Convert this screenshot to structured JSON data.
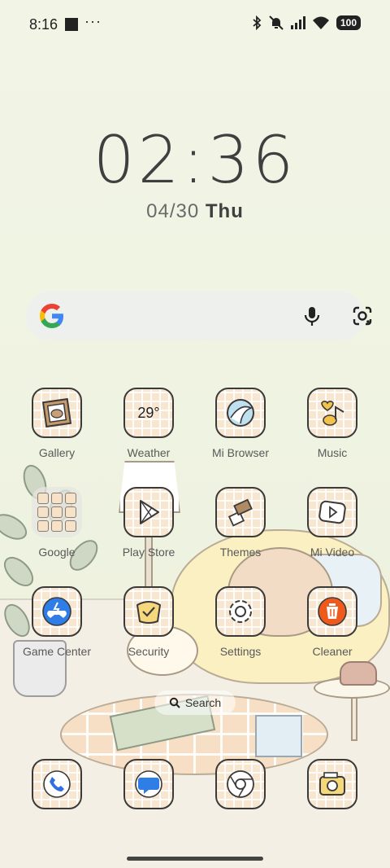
{
  "status_bar": {
    "time": "8:16",
    "more": "···",
    "battery": "100",
    "icons": [
      "square-notification-icon",
      "bluetooth-icon",
      "mute-icon",
      "signal-icon",
      "wifi-icon",
      "battery-icon"
    ]
  },
  "clock_widget": {
    "time": "02:36",
    "date": "04/30",
    "weekday": "Thu"
  },
  "search_widget": {
    "icons": [
      "google-g-icon",
      "mic-icon",
      "google-lens-icon"
    ]
  },
  "apps": [
    {
      "label": "Gallery",
      "icon": "gallery-icon"
    },
    {
      "label": "Weather",
      "icon": "weather-icon",
      "value": "29°"
    },
    {
      "label": "Mi Browser",
      "icon": "browser-icon"
    },
    {
      "label": "Music",
      "icon": "music-icon"
    },
    {
      "label": "Google",
      "icon": "folder-icon"
    },
    {
      "label": "Play Store",
      "icon": "play-store-icon"
    },
    {
      "label": "Themes",
      "icon": "themes-icon"
    },
    {
      "label": "Mi Video",
      "icon": "video-icon"
    },
    {
      "label": "Game Center",
      "icon": "game-icon"
    },
    {
      "label": "Security",
      "icon": "security-icon"
    },
    {
      "label": "Settings",
      "icon": "settings-icon"
    },
    {
      "label": "Cleaner",
      "icon": "cleaner-icon"
    }
  ],
  "page_search": {
    "label": "Search"
  },
  "dock": [
    {
      "icon": "phone-icon"
    },
    {
      "icon": "messages-icon"
    },
    {
      "icon": "chrome-icon"
    },
    {
      "icon": "camera-icon"
    }
  ],
  "colors": {
    "background": "#f1f3e4",
    "tile": "#f8e7d0",
    "outline": "#3a3a3a",
    "cleaner_orange": "#ef5a1c",
    "game_blue": "#2f7de6"
  }
}
